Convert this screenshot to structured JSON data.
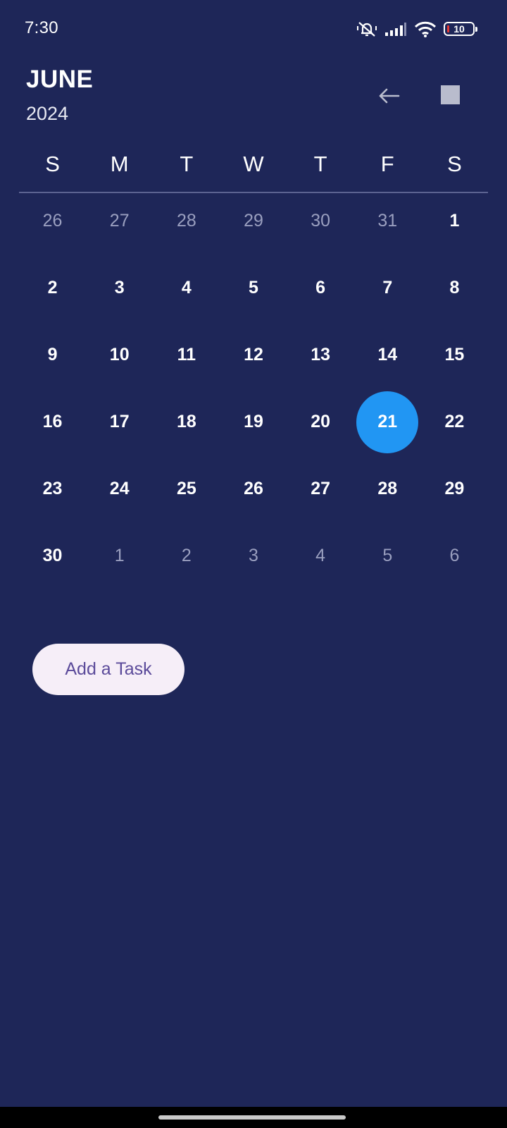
{
  "status_bar": {
    "time": "7:30",
    "battery_level": "10",
    "icons": [
      "silent-bell-icon",
      "cell-signal-icon",
      "wifi-icon",
      "battery-icon"
    ]
  },
  "header": {
    "month": "JUNE",
    "year": "2024",
    "back_icon": "arrow-left-icon",
    "square_icon": "square-icon"
  },
  "calendar": {
    "weekdays": [
      "S",
      "M",
      "T",
      "W",
      "T",
      "F",
      "S"
    ],
    "days": [
      {
        "label": "26",
        "in_month": false
      },
      {
        "label": "27",
        "in_month": false
      },
      {
        "label": "28",
        "in_month": false
      },
      {
        "label": "29",
        "in_month": false
      },
      {
        "label": "30",
        "in_month": false
      },
      {
        "label": "31",
        "in_month": false
      },
      {
        "label": "1",
        "in_month": true
      },
      {
        "label": "2",
        "in_month": true
      },
      {
        "label": "3",
        "in_month": true
      },
      {
        "label": "4",
        "in_month": true
      },
      {
        "label": "5",
        "in_month": true
      },
      {
        "label": "6",
        "in_month": true
      },
      {
        "label": "7",
        "in_month": true
      },
      {
        "label": "8",
        "in_month": true
      },
      {
        "label": "9",
        "in_month": true
      },
      {
        "label": "10",
        "in_month": true
      },
      {
        "label": "11",
        "in_month": true
      },
      {
        "label": "12",
        "in_month": true
      },
      {
        "label": "13",
        "in_month": true
      },
      {
        "label": "14",
        "in_month": true
      },
      {
        "label": "15",
        "in_month": true
      },
      {
        "label": "16",
        "in_month": true
      },
      {
        "label": "17",
        "in_month": true
      },
      {
        "label": "18",
        "in_month": true
      },
      {
        "label": "19",
        "in_month": true
      },
      {
        "label": "20",
        "in_month": true
      },
      {
        "label": "21",
        "in_month": true,
        "selected": true
      },
      {
        "label": "22",
        "in_month": true
      },
      {
        "label": "23",
        "in_month": true
      },
      {
        "label": "24",
        "in_month": true
      },
      {
        "label": "25",
        "in_month": true
      },
      {
        "label": "26",
        "in_month": true
      },
      {
        "label": "27",
        "in_month": true
      },
      {
        "label": "28",
        "in_month": true
      },
      {
        "label": "29",
        "in_month": true
      },
      {
        "label": "30",
        "in_month": true
      },
      {
        "label": "1",
        "in_month": false
      },
      {
        "label": "2",
        "in_month": false
      },
      {
        "label": "3",
        "in_month": false
      },
      {
        "label": "4",
        "in_month": false
      },
      {
        "label": "5",
        "in_month": false
      },
      {
        "label": "6",
        "in_month": false
      }
    ]
  },
  "actions": {
    "add_task_label": "Add a Task"
  },
  "colors": {
    "background": "#1e2658",
    "selected_day": "#2196f3",
    "button_bg": "#f6eef8",
    "button_text": "#5b4a9a",
    "muted_day": "#9a9fbf"
  }
}
